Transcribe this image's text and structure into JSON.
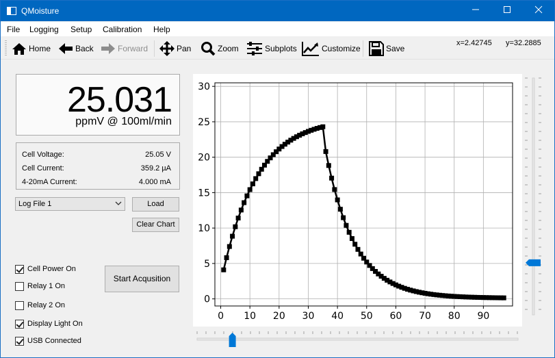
{
  "window": {
    "title": "QMoisture"
  },
  "menu": [
    "File",
    "Logging",
    "Setup",
    "Calibration",
    "Help"
  ],
  "toolbar": {
    "home": "Home",
    "back": "Back",
    "forward": "Forward",
    "pan": "Pan",
    "zoom": "Zoom",
    "subplots": "Subplots",
    "customize": "Customize",
    "save": "Save",
    "coord_x": "x=2.42745",
    "coord_y": "y=32.2885"
  },
  "reading": {
    "value": "25.031",
    "unit": "ppmV @ 100ml/min"
  },
  "info": [
    {
      "label": "Cell Voltage:",
      "value": "25.05 V"
    },
    {
      "label": "Cell Current:",
      "value": "359.2 µA"
    },
    {
      "label": "4-20mA Current:",
      "value": "4.000 mA"
    }
  ],
  "log_select": {
    "value": "Log File 1"
  },
  "buttons": {
    "load": "Load",
    "clear_chart": "Clear Chart",
    "start": "Start Acqusition"
  },
  "checkboxes": [
    {
      "label": "Cell Power On",
      "checked": true
    },
    {
      "label": "Relay 1 On",
      "checked": false
    },
    {
      "label": "Relay 2 On",
      "checked": false
    },
    {
      "label": "Display Light On",
      "checked": true
    },
    {
      "label": "USB Connected",
      "checked": true
    }
  ],
  "sliders": {
    "vertical_level": 0.22,
    "horizontal_level": 0.11,
    "accent": "#0078d7"
  },
  "chart_data": {
    "type": "line",
    "xlim": [
      -2,
      100
    ],
    "ylim": [
      -1,
      30.5
    ],
    "xticks": [
      0,
      10,
      20,
      30,
      40,
      50,
      60,
      70,
      80,
      90
    ],
    "yticks": [
      0,
      5,
      10,
      15,
      20,
      25,
      30
    ],
    "grid": true,
    "line_color": "#000000",
    "marker": "square",
    "rise": {
      "x_start": 1,
      "x_end": 35,
      "y_start": 4.1,
      "y_end": 24.3,
      "tau": 12,
      "points": 35
    },
    "decay": {
      "x_start": 36,
      "x_end": 97,
      "y_start": 20.8,
      "y_end": 0.1,
      "tau": 10,
      "points": 62
    }
  }
}
